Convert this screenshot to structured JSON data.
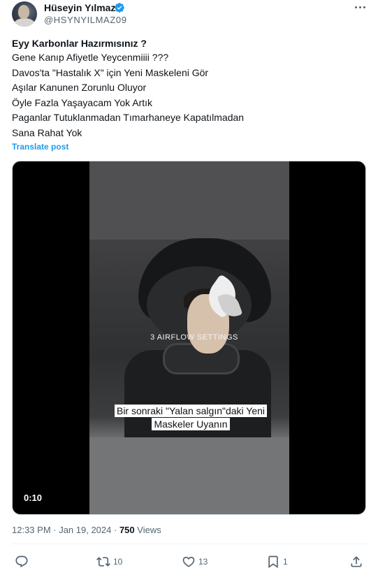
{
  "tweet": {
    "author_name": "Hüseyin Yılmaz",
    "author_handle": "@HSYNYILMAZ09",
    "title": "Eyy Karbonlar Hazırmısınız ?",
    "lines": [
      "Gene Kanıp Afiyetle Yeycenmiiii ???",
      "Davos'ta \"Hastalık X\" için Yeni Maskeleni Gör",
      "Aşılar Kanunen Zorunlu Oluyor",
      "Öyle Fazla Yaşayacam Yok Artık",
      "Paganlar Tutuklanmadan Tımarhaneye Kapatılmadan",
      "Sana Rahat Yok"
    ],
    "translate_label": "Translate post",
    "timestamp": "12:33 PM · Jan 19, 2024 ·",
    "views_count": "750",
    "views_label": "Views"
  },
  "video": {
    "overlay_text": "3 AIRFLOW SETTINGS",
    "caption_line1": "Bir sonraki \"Yalan salgın\"daki Yeni",
    "caption_line2": "Maskeler Uyanın",
    "duration": "0:10"
  },
  "actions": {
    "replies": "",
    "reposts": "10",
    "likes": "13",
    "bookmarks": "1"
  },
  "colors": {
    "accent": "#1d9bf0",
    "secondary_text": "#536471",
    "primary_text": "#0f1419"
  }
}
